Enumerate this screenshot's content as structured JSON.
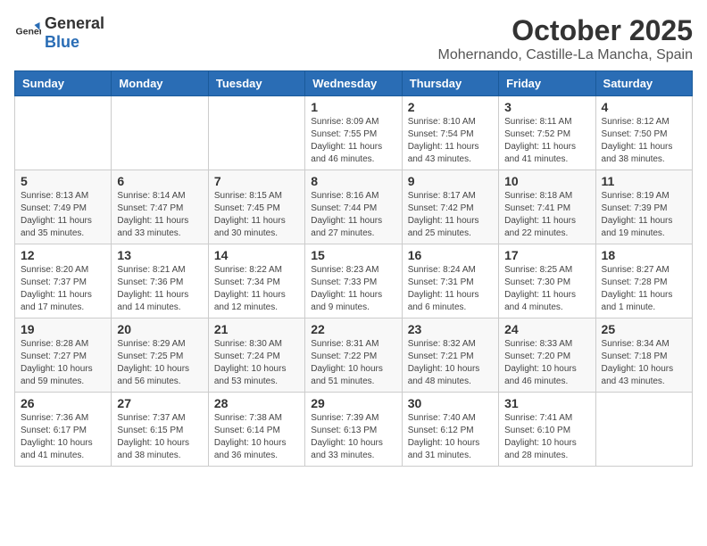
{
  "header": {
    "logo_general": "General",
    "logo_blue": "Blue",
    "month": "October 2025",
    "location": "Mohernando, Castille-La Mancha, Spain"
  },
  "days_of_week": [
    "Sunday",
    "Monday",
    "Tuesday",
    "Wednesday",
    "Thursday",
    "Friday",
    "Saturday"
  ],
  "weeks": [
    [
      {
        "day": "",
        "info": ""
      },
      {
        "day": "",
        "info": ""
      },
      {
        "day": "",
        "info": ""
      },
      {
        "day": "1",
        "info": "Sunrise: 8:09 AM\nSunset: 7:55 PM\nDaylight: 11 hours and 46 minutes."
      },
      {
        "day": "2",
        "info": "Sunrise: 8:10 AM\nSunset: 7:54 PM\nDaylight: 11 hours and 43 minutes."
      },
      {
        "day": "3",
        "info": "Sunrise: 8:11 AM\nSunset: 7:52 PM\nDaylight: 11 hours and 41 minutes."
      },
      {
        "day": "4",
        "info": "Sunrise: 8:12 AM\nSunset: 7:50 PM\nDaylight: 11 hours and 38 minutes."
      }
    ],
    [
      {
        "day": "5",
        "info": "Sunrise: 8:13 AM\nSunset: 7:49 PM\nDaylight: 11 hours and 35 minutes."
      },
      {
        "day": "6",
        "info": "Sunrise: 8:14 AM\nSunset: 7:47 PM\nDaylight: 11 hours and 33 minutes."
      },
      {
        "day": "7",
        "info": "Sunrise: 8:15 AM\nSunset: 7:45 PM\nDaylight: 11 hours and 30 minutes."
      },
      {
        "day": "8",
        "info": "Sunrise: 8:16 AM\nSunset: 7:44 PM\nDaylight: 11 hours and 27 minutes."
      },
      {
        "day": "9",
        "info": "Sunrise: 8:17 AM\nSunset: 7:42 PM\nDaylight: 11 hours and 25 minutes."
      },
      {
        "day": "10",
        "info": "Sunrise: 8:18 AM\nSunset: 7:41 PM\nDaylight: 11 hours and 22 minutes."
      },
      {
        "day": "11",
        "info": "Sunrise: 8:19 AM\nSunset: 7:39 PM\nDaylight: 11 hours and 19 minutes."
      }
    ],
    [
      {
        "day": "12",
        "info": "Sunrise: 8:20 AM\nSunset: 7:37 PM\nDaylight: 11 hours and 17 minutes."
      },
      {
        "day": "13",
        "info": "Sunrise: 8:21 AM\nSunset: 7:36 PM\nDaylight: 11 hours and 14 minutes."
      },
      {
        "day": "14",
        "info": "Sunrise: 8:22 AM\nSunset: 7:34 PM\nDaylight: 11 hours and 12 minutes."
      },
      {
        "day": "15",
        "info": "Sunrise: 8:23 AM\nSunset: 7:33 PM\nDaylight: 11 hours and 9 minutes."
      },
      {
        "day": "16",
        "info": "Sunrise: 8:24 AM\nSunset: 7:31 PM\nDaylight: 11 hours and 6 minutes."
      },
      {
        "day": "17",
        "info": "Sunrise: 8:25 AM\nSunset: 7:30 PM\nDaylight: 11 hours and 4 minutes."
      },
      {
        "day": "18",
        "info": "Sunrise: 8:27 AM\nSunset: 7:28 PM\nDaylight: 11 hours and 1 minute."
      }
    ],
    [
      {
        "day": "19",
        "info": "Sunrise: 8:28 AM\nSunset: 7:27 PM\nDaylight: 10 hours and 59 minutes."
      },
      {
        "day": "20",
        "info": "Sunrise: 8:29 AM\nSunset: 7:25 PM\nDaylight: 10 hours and 56 minutes."
      },
      {
        "day": "21",
        "info": "Sunrise: 8:30 AM\nSunset: 7:24 PM\nDaylight: 10 hours and 53 minutes."
      },
      {
        "day": "22",
        "info": "Sunrise: 8:31 AM\nSunset: 7:22 PM\nDaylight: 10 hours and 51 minutes."
      },
      {
        "day": "23",
        "info": "Sunrise: 8:32 AM\nSunset: 7:21 PM\nDaylight: 10 hours and 48 minutes."
      },
      {
        "day": "24",
        "info": "Sunrise: 8:33 AM\nSunset: 7:20 PM\nDaylight: 10 hours and 46 minutes."
      },
      {
        "day": "25",
        "info": "Sunrise: 8:34 AM\nSunset: 7:18 PM\nDaylight: 10 hours and 43 minutes."
      }
    ],
    [
      {
        "day": "26",
        "info": "Sunrise: 7:36 AM\nSunset: 6:17 PM\nDaylight: 10 hours and 41 minutes."
      },
      {
        "day": "27",
        "info": "Sunrise: 7:37 AM\nSunset: 6:15 PM\nDaylight: 10 hours and 38 minutes."
      },
      {
        "day": "28",
        "info": "Sunrise: 7:38 AM\nSunset: 6:14 PM\nDaylight: 10 hours and 36 minutes."
      },
      {
        "day": "29",
        "info": "Sunrise: 7:39 AM\nSunset: 6:13 PM\nDaylight: 10 hours and 33 minutes."
      },
      {
        "day": "30",
        "info": "Sunrise: 7:40 AM\nSunset: 6:12 PM\nDaylight: 10 hours and 31 minutes."
      },
      {
        "day": "31",
        "info": "Sunrise: 7:41 AM\nSunset: 6:10 PM\nDaylight: 10 hours and 28 minutes."
      },
      {
        "day": "",
        "info": ""
      }
    ]
  ]
}
